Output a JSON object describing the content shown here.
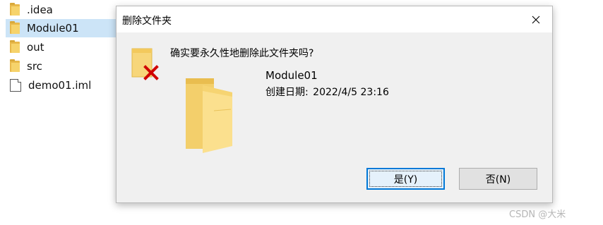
{
  "explorer": {
    "files": [
      {
        "name": ".idea",
        "icon": "folder-icon",
        "selected": false
      },
      {
        "name": "Module01",
        "icon": "folder-icon",
        "selected": true
      },
      {
        "name": "out",
        "icon": "folder-icon",
        "selected": false
      },
      {
        "name": "src",
        "icon": "folder-icon",
        "selected": false
      },
      {
        "name": "demo01.iml",
        "icon": "file-icon",
        "selected": false
      }
    ]
  },
  "dialog": {
    "title": "删除文件夹",
    "question": "确实要永久性地删除此文件夹吗?",
    "item_name": "Module01",
    "date_label": "创建日期:",
    "date_value": "2022/4/5 23:16",
    "yes_label": "是(Y)",
    "no_label": "否(N)",
    "close_icon": "close-icon",
    "warning_icon": "delete-folder-icon",
    "folder_icon": "folder-icon"
  },
  "watermark": "CSDN @大米",
  "colors": {
    "dialog_bg": "#f0f0f0",
    "selection": "#cce4f7",
    "default_button_border": "#0078d7",
    "delete_x": "#d00000",
    "folder": "#f6d36b"
  }
}
